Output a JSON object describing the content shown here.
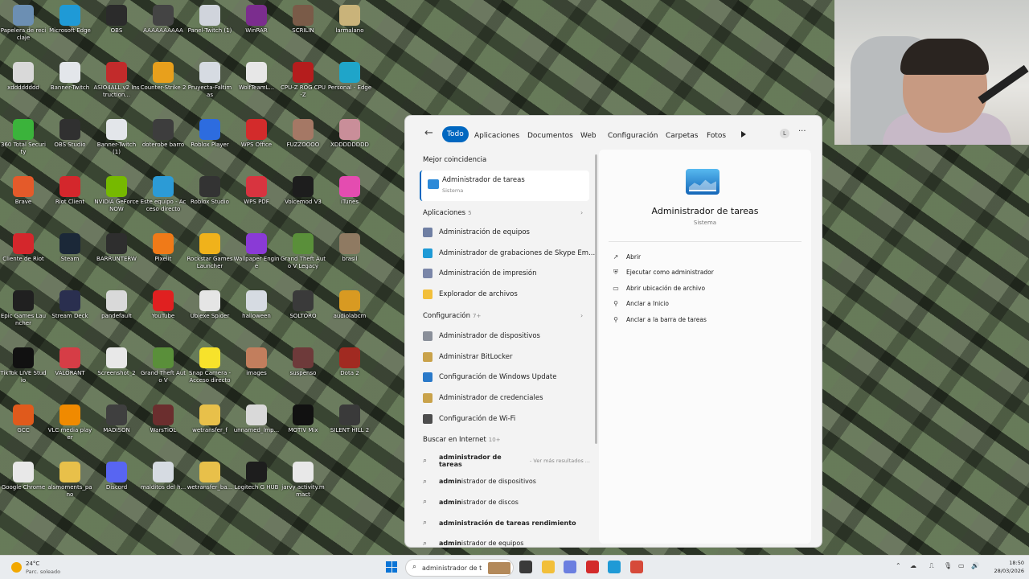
{
  "desktop": {
    "icons": [
      {
        "label": "Papelera de reciclaje",
        "color": "#6c8fb3"
      },
      {
        "label": "Microsoft Edge",
        "color": "#1f9ad6"
      },
      {
        "label": "OBS",
        "color": "#2b2b2b"
      },
      {
        "label": "AAAAAAAAAA",
        "color": "#444444"
      },
      {
        "label": "Panel-Twitch (1)",
        "color": "#d0d4dc"
      },
      {
        "label": "WinRAR",
        "color": "#7b2d8e"
      },
      {
        "label": "SCRILIN",
        "color": "#7a5b48"
      },
      {
        "label": "larmalano",
        "color": "#c9b37a"
      },
      {
        "label": "xdddddddd",
        "color": "#d9d9d9"
      },
      {
        "label": "Banner-Twitch",
        "color": "#e3e6ea"
      },
      {
        "label": "ASIO4ALL v2 Instruction...",
        "color": "#c22b2b"
      },
      {
        "label": "Counter-Strike 2",
        "color": "#e8a01c"
      },
      {
        "label": "Pruyecta-Faltimas",
        "color": "#d6dbe2"
      },
      {
        "label": "WolfTeamL...",
        "color": "#e7e7e7"
      },
      {
        "label": "CPU-Z ROG CPU-Z",
        "color": "#b51d1d"
      },
      {
        "label": "Personal - Edge",
        "color": "#1fa5c9"
      },
      {
        "label": "360 Total Security",
        "color": "#3bb33b"
      },
      {
        "label": "OBS Studio",
        "color": "#303030"
      },
      {
        "label": "Banner-Twitch (1)",
        "color": "#e3e6ea"
      },
      {
        "label": "doterobe barro",
        "color": "#3d3d3d"
      },
      {
        "label": "Roblox Player",
        "color": "#2d6cdf"
      },
      {
        "label": "WPS Office",
        "color": "#d32b2b"
      },
      {
        "label": "FUZZOOOO",
        "color": "#a57865"
      },
      {
        "label": "XDDDDDDDD",
        "color": "#c98e99"
      },
      {
        "label": "Brave",
        "color": "#e45a2a"
      },
      {
        "label": "Riot Client",
        "color": "#d4272c"
      },
      {
        "label": "NVIDIA GeForce NOW",
        "color": "#76b900"
      },
      {
        "label": "Este equipo - Acceso directo",
        "color": "#2c9bd6"
      },
      {
        "label": "Roblox Studio",
        "color": "#333333"
      },
      {
        "label": "WPS PDF",
        "color": "#d8343f"
      },
      {
        "label": "Voicemod V3",
        "color": "#1d1d1d"
      },
      {
        "label": "iTunes",
        "color": "#e44cb0"
      },
      {
        "label": "Cliente de Riot",
        "color": "#d4272c"
      },
      {
        "label": "Steam",
        "color": "#1b2838"
      },
      {
        "label": "BARRUNTERW",
        "color": "#2e2e2e"
      },
      {
        "label": "Pixelit",
        "color": "#f07a18"
      },
      {
        "label": "Rockstar Games Launcher",
        "color": "#f0b21b"
      },
      {
        "label": "Wallpaper Engine",
        "color": "#8a3ad6"
      },
      {
        "label": "Grand Theft Auto V Legacy",
        "color": "#5a8f3a"
      },
      {
        "label": "brasil",
        "color": "#8f7a62"
      },
      {
        "label": "Epic Games Launcher",
        "color": "#202020"
      },
      {
        "label": "Stream Deck",
        "color": "#2a2f4f"
      },
      {
        "label": "pandefault",
        "color": "#d9d9d9"
      },
      {
        "label": "YouTube",
        "color": "#e02020"
      },
      {
        "label": "Ubiexe Spider",
        "color": "#e5e5e5"
      },
      {
        "label": "halloween",
        "color": "#d6dbe2"
      },
      {
        "label": "SOLTORO",
        "color": "#3a3a3a"
      },
      {
        "label": "audiolabcm",
        "color": "#d89a22"
      },
      {
        "label": "TikTok LIVE Studio",
        "color": "#111111"
      },
      {
        "label": "VALORANT",
        "color": "#d63d46"
      },
      {
        "label": "Screenshot_2",
        "color": "#e8e8e8"
      },
      {
        "label": "Grand Theft Auto V",
        "color": "#5a8f3a"
      },
      {
        "label": "Snap Camera - Acceso directo",
        "color": "#f7e22b"
      },
      {
        "label": "images",
        "color": "#c27e5d"
      },
      {
        "label": "suspenso",
        "color": "#6e3a3a"
      },
      {
        "label": "Dota 2",
        "color": "#a12a21"
      },
      {
        "label": "GCC",
        "color": "#e05a1c"
      },
      {
        "label": "VLC media player",
        "color": "#f08a00"
      },
      {
        "label": "MADISON",
        "color": "#3f3f3f"
      },
      {
        "label": "WarsTiOL",
        "color": "#6b2e2e"
      },
      {
        "label": "wetransfer_f",
        "color": "#e8c04a"
      },
      {
        "label": "unnamed_lmp...",
        "color": "#d9d9d9"
      },
      {
        "label": "MOTIV Mix",
        "color": "#111111"
      },
      {
        "label": "SILENT HILL 2",
        "color": "#3a3a3a"
      },
      {
        "label": "Google Chrome",
        "color": "#e8e8e8"
      },
      {
        "label": "alsmoments_pano",
        "color": "#e8c04a"
      },
      {
        "label": "Discord",
        "color": "#5865f2"
      },
      {
        "label": "malditos del h...",
        "color": "#d6dbe2"
      },
      {
        "label": "wetransfer_ba...",
        "color": "#e8c04a"
      },
      {
        "label": "Logitech G HUB",
        "color": "#1d1d1d"
      },
      {
        "label": "jarvy activity.mmact",
        "color": "#e8e8e8"
      }
    ]
  },
  "search_panel": {
    "tabs": [
      "Todo",
      "Aplicaciones",
      "Documentos",
      "Web",
      "Configuración",
      "Carpetas",
      "Fotos"
    ],
    "active_tab": "Todo",
    "user_initial": "L",
    "best_match_heading": "Mejor coincidencia",
    "best_match": {
      "title": "Administrador de tareas",
      "subtitle": "Sistema"
    },
    "apps_heading": "Aplicaciones",
    "apps_count": "5",
    "apps": [
      {
        "label": "Administración de equipos",
        "color": "#6f7fa3"
      },
      {
        "label": "Administrador de grabaciones de Skype Em...",
        "color": "#1e9ad6"
      },
      {
        "label": "Administración de impresión",
        "color": "#7a86a8"
      },
      {
        "label": "Explorador de archivos",
        "color": "#f2bf3a"
      }
    ],
    "config_heading": "Configuración",
    "config_count": "7+",
    "config": [
      {
        "label": "Administrador de dispositivos",
        "color": "#8a8f99"
      },
      {
        "label": "Administrar BitLocker",
        "color": "#c9a24a"
      },
      {
        "label": "Configuración de Windows Update",
        "color": "#2a79c9"
      },
      {
        "label": "Administrador de credenciales",
        "color": "#c9a24a"
      },
      {
        "label": "Configuración de Wi-Fi",
        "color": "#4d4d4d"
      }
    ],
    "web_heading": "Buscar en Internet",
    "web_count": "10+",
    "web": [
      {
        "bold": "administrador de tareas",
        "rest": "",
        "hint": "- Ver más resultados ..."
      },
      {
        "bold": "admin",
        "rest": "istrador de dispositivos",
        "hint": ""
      },
      {
        "bold": "admin",
        "rest": "istrador de discos",
        "hint": ""
      },
      {
        "bold": "administración de tareas rendimiento",
        "rest": "",
        "hint": ""
      },
      {
        "bold": "admin",
        "rest": "istrador de equipos",
        "hint": ""
      }
    ],
    "detail": {
      "title": "Administrador de tareas",
      "subtitle": "Sistema",
      "actions": [
        {
          "label": "Abrir",
          "icon": "open-icon",
          "glyph": "↗"
        },
        {
          "label": "Ejecutar como administrador",
          "icon": "shield-icon",
          "glyph": "⛨"
        },
        {
          "label": "Abrir ubicación de archivo",
          "icon": "folder-icon",
          "glyph": "▭"
        },
        {
          "label": "Anclar a Inicio",
          "icon": "pin-icon",
          "glyph": "⚲"
        },
        {
          "label": "Anclar a la barra de tareas",
          "icon": "pin-taskbar-icon",
          "glyph": "⚲"
        }
      ]
    }
  },
  "taskbar": {
    "weather_temp": "24°C",
    "weather_cond": "Parc. soleado",
    "search_value": "administrador de t",
    "time": "18:50",
    "date": "28/03/2026",
    "apps": [
      {
        "name": "task-view-icon",
        "color": "#3a3a3a"
      },
      {
        "name": "file-explorer-icon",
        "color": "#f2bf3a"
      },
      {
        "name": "copilot-icon",
        "color": "#6b7fe0"
      },
      {
        "name": "wps-icon",
        "color": "#d32b2b"
      },
      {
        "name": "edge-icon",
        "color": "#1f9ad6"
      },
      {
        "name": "chrome-icon",
        "color": "#d64a3a"
      }
    ]
  }
}
